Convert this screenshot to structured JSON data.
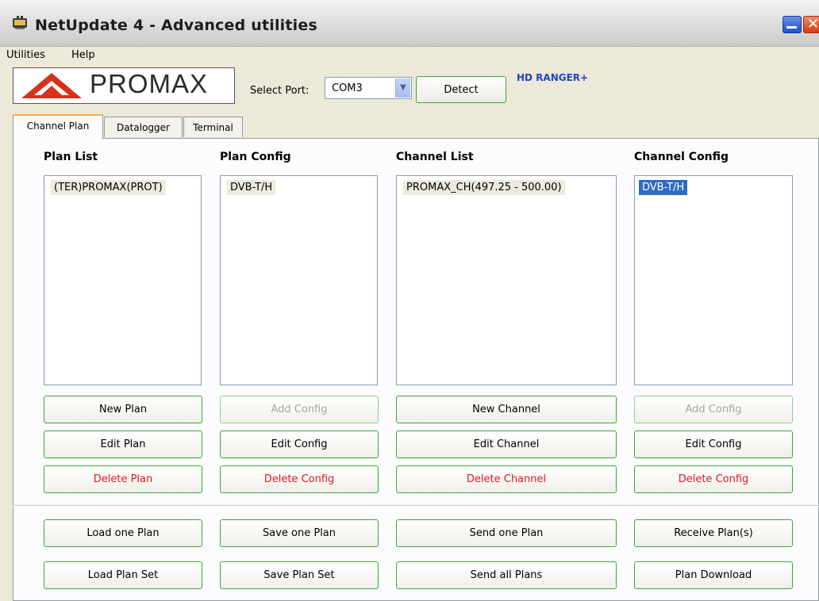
{
  "window": {
    "title": "NetUpdate 4 - Advanced utilities"
  },
  "menu": {
    "items": [
      "Utilities",
      "Help"
    ]
  },
  "toolbar": {
    "logo_text": "PROMAX",
    "port_label": "Select Port:",
    "port_value": "COM3",
    "detect_label": "Detect",
    "device": "HD RANGER+"
  },
  "tabs": [
    "Channel Plan",
    "Datalogger",
    "Terminal"
  ],
  "columns": [
    {
      "header": "Plan List",
      "items": [
        "(TER)PROMAX(PROT)"
      ],
      "buttons": [
        "New Plan",
        "Edit Plan",
        "Delete Plan"
      ],
      "bottom_buttons": [
        "Load one Plan",
        "Load Plan Set"
      ]
    },
    {
      "header": "Plan Config",
      "items": [
        "DVB-T/H"
      ],
      "buttons": [
        "Add Config",
        "Edit Config",
        "Delete Config"
      ],
      "bottom_buttons": [
        "Save one Plan",
        "Save Plan Set"
      ]
    },
    {
      "header": "Channel List",
      "items": [
        "PROMAX_CH(497.25 - 500.00)"
      ],
      "buttons": [
        "New Channel",
        "Edit Channel",
        "Delete Channel"
      ],
      "bottom_buttons": [
        "Send one Plan",
        "Send all Plans"
      ]
    },
    {
      "header": "Channel Config",
      "items": [
        "DVB-T/H"
      ],
      "buttons": [
        "Add Config",
        "Edit Config",
        "Delete Config"
      ],
      "bottom_buttons": [
        "Receive Plan(s)",
        "Plan Download"
      ]
    }
  ],
  "colors": {
    "accent_green": "#3aa63a",
    "danger_red": "#e0191d",
    "selection_blue": "#316ac5",
    "device_blue": "#1e45c8"
  }
}
